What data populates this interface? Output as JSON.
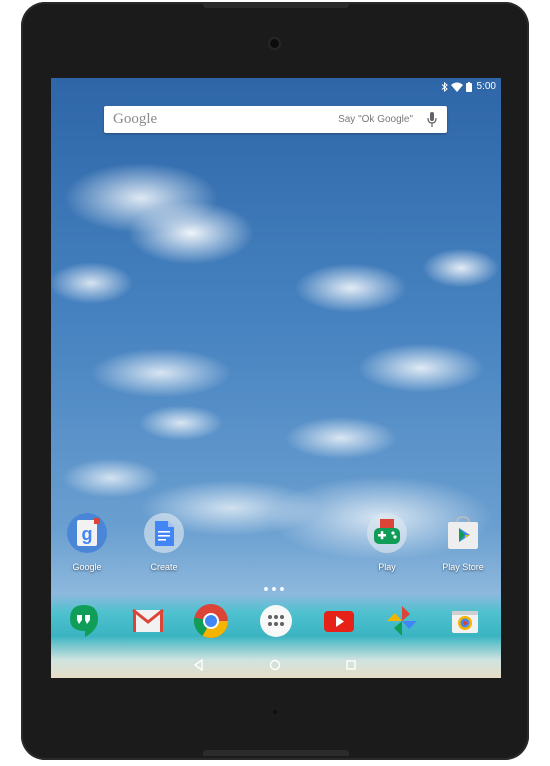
{
  "status_bar": {
    "time": "5:00",
    "icons": [
      "bluetooth-icon",
      "wifi-icon",
      "battery-icon"
    ]
  },
  "search_widget": {
    "logo_text": "Google",
    "hint": "Say \"Ok Google\"",
    "icon": "mic-icon"
  },
  "home_apps": [
    {
      "label": "Google",
      "icon": "google-search-app-icon"
    },
    {
      "label": "Create",
      "icon": "docs-folder-icon"
    },
    {
      "label": "Play",
      "icon": "play-games-icon"
    },
    {
      "label": "Play Store",
      "icon": "play-store-icon"
    }
  ],
  "page_indicator": {
    "pages": 3,
    "current": 2
  },
  "dock": [
    "hangouts-icon",
    "gmail-icon",
    "chrome-icon",
    "app-drawer-icon",
    "youtube-icon",
    "photos-icon",
    "camera-icon"
  ],
  "nav_bar": [
    "back-icon",
    "home-icon",
    "recents-icon"
  ],
  "colors": {
    "sky": "#2e66a8",
    "frame": "#1b1b1b",
    "google_blue": "#4285f4",
    "google_red": "#db4437",
    "google_yellow": "#f4b400",
    "google_green": "#0f9d58"
  }
}
